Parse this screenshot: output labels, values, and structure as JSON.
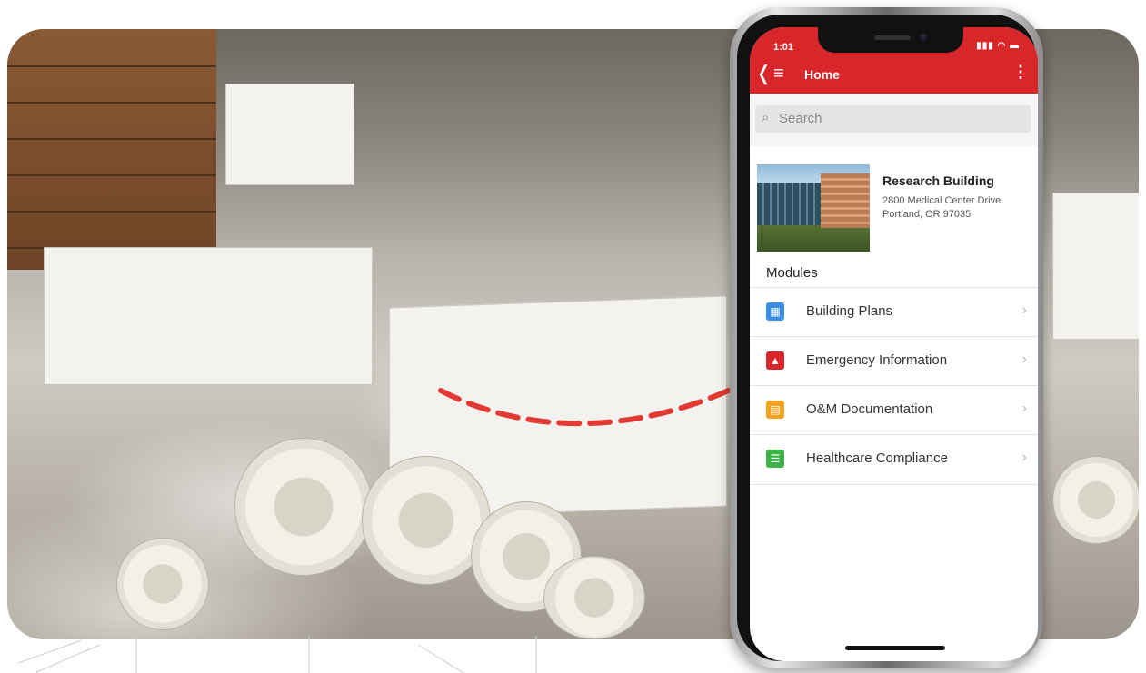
{
  "phone": {
    "status_time": "1:01",
    "status_icons": "▮▮▮ ◠ ▬"
  },
  "appbar": {
    "back_glyph": "❬",
    "menu_glyph": "≡",
    "title": "Home",
    "overflow_glyph": "⋮"
  },
  "search": {
    "placeholder": "Search",
    "icon": "search-icon"
  },
  "building": {
    "name": "Research Building",
    "address_line1": "2800 Medical Center Drive",
    "address_line2": "Portland, OR 97035"
  },
  "modules": {
    "heading": "Modules",
    "items": [
      {
        "label": "Building Plans",
        "icon": "building-icon",
        "color": "#3a8ee6"
      },
      {
        "label": "Emergency Information",
        "icon": "alarm-icon",
        "color": "#d9262a"
      },
      {
        "label": "O&M Documentation",
        "icon": "manual-icon",
        "color": "#f2a41f"
      },
      {
        "label": "Healthcare Compliance",
        "icon": "checklist-icon",
        "color": "#3cb44a"
      }
    ],
    "chevron": "›"
  },
  "colors": {
    "brand_red": "#d9262a",
    "arrow_red": "#e23a32"
  }
}
